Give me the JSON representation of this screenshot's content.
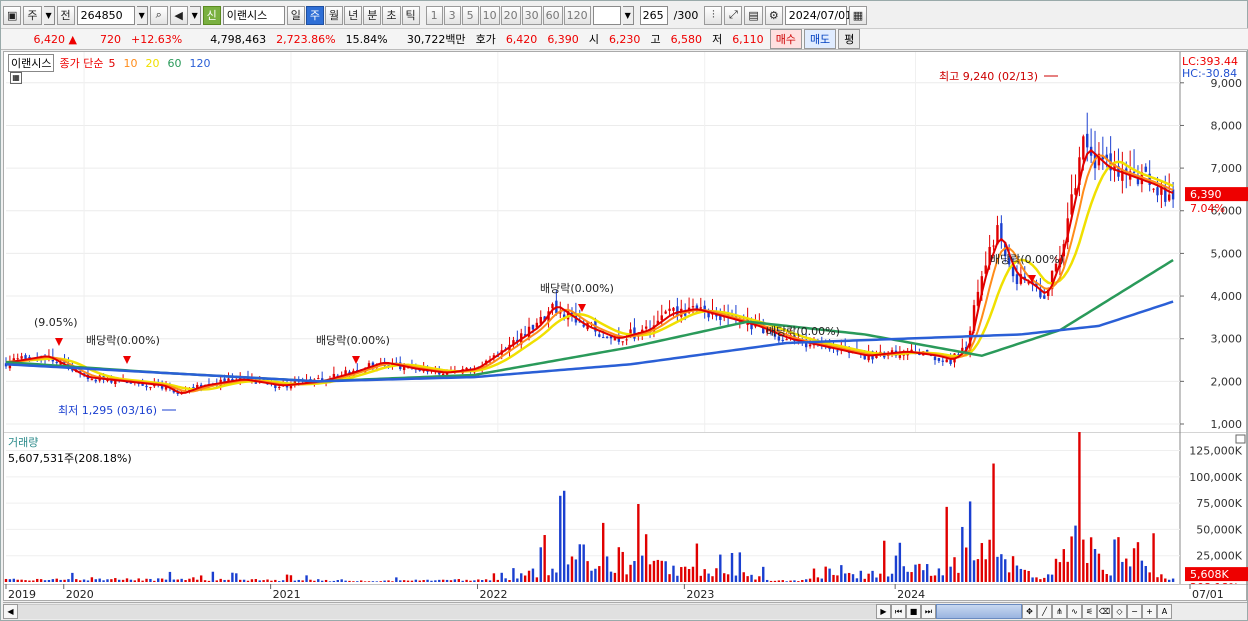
{
  "toolbar": {
    "period_label": "주",
    "prev_label": "전",
    "code": "264850",
    "credit_label": "신",
    "stock_name": "이랜시스",
    "periods": [
      {
        "label": "일",
        "selected": false
      },
      {
        "label": "주",
        "selected": true
      },
      {
        "label": "월",
        "selected": false
      },
      {
        "label": "년",
        "selected": false
      },
      {
        "label": "분",
        "selected": false
      },
      {
        "label": "초",
        "selected": false
      },
      {
        "label": "틱",
        "selected": false
      }
    ],
    "intervals": [
      "1",
      "3",
      "5",
      "10",
      "20",
      "30",
      "60",
      "120"
    ],
    "count": "265",
    "count_total": "/300",
    "date": "2024/07/01"
  },
  "quote": {
    "price": "6,420",
    "change": "720",
    "change_pct": "+12.63%",
    "volume": "4,798,463",
    "volume_pct": "2,723.86%",
    "turnover": "15.84%",
    "amount": "30,722백만",
    "hoga_label": "호가",
    "hoga_ask": "6,420",
    "hoga_bid": "6,390",
    "open_label": "시",
    "open": "6,230",
    "high_label": "고",
    "high": "6,580",
    "low_label": "저",
    "low": "6,110",
    "buy_label": "매수",
    "sell_label": "매도",
    "eval_label": "평"
  },
  "price_panel": {
    "name_tag": "이랜시스",
    "ma_title": "종가 단순",
    "ma_periods": [
      {
        "label": "5",
        "color": "#e00000"
      },
      {
        "label": "10",
        "color": "#ff8c1a"
      },
      {
        "label": "20",
        "color": "#f0e000"
      },
      {
        "label": "60",
        "color": "#2a9a5a"
      },
      {
        "label": "120",
        "color": "#2a5fd6"
      }
    ],
    "lc": "LC:393.44",
    "hc": "HC:-30.84",
    "y_ticks": [
      "9,000",
      "8,000",
      "7,000",
      "6,000",
      "5,000",
      "4,000",
      "3,000",
      "2,000",
      "1,000"
    ],
    "current_price": "6,390",
    "current_pct": "7.04%",
    "annotations": {
      "max": "최고 9,240 (02/13)",
      "min": "최저 1,295 (03/16)",
      "split": "(9.05%)",
      "div1": "배당락(0.00%)",
      "div2": "배당락(0.00%)",
      "div3": "배당락(0.00%)",
      "div4": "배당락(0.00%)",
      "div5": "배당락(0.00%)"
    }
  },
  "volume_panel": {
    "title": "거래량",
    "value": "5,607,531주(208.18%)",
    "y_ticks": [
      "125,000K",
      "100,000K",
      "75,000K",
      "50,000K",
      "25,000K"
    ],
    "current_vol": "5,608K",
    "current_pct": "208.18%"
  },
  "x_axis": [
    "2019",
    "2020",
    "2021",
    "2022",
    "2023",
    "2024",
    "07/01"
  ],
  "colors": {
    "up": "#e00000",
    "down": "#1a3fd0",
    "ma5": "#e00000",
    "ma10": "#ff8c1a",
    "ma20": "#f0e000",
    "ma60": "#2a9a5a",
    "ma120": "#2a5fd6"
  },
  "chart_data": {
    "type": "candlestick",
    "price_range": [
      1000,
      9300
    ],
    "weeks": 265,
    "close": [
      [
        0,
        2450
      ],
      [
        10,
        2600
      ],
      [
        14,
        2400
      ],
      [
        20,
        2100
      ],
      [
        30,
        2000
      ],
      [
        40,
        1900
      ],
      [
        44,
        1700
      ],
      [
        50,
        1900
      ],
      [
        60,
        2050
      ],
      [
        70,
        1900
      ],
      [
        80,
        2000
      ],
      [
        88,
        2200
      ],
      [
        96,
        2450
      ],
      [
        104,
        2300
      ],
      [
        112,
        2200
      ],
      [
        120,
        2300
      ],
      [
        128,
        2800
      ],
      [
        136,
        3300
      ],
      [
        140,
        3800
      ],
      [
        148,
        3300
      ],
      [
        156,
        3000
      ],
      [
        164,
        3200
      ],
      [
        170,
        3600
      ],
      [
        176,
        3700
      ],
      [
        184,
        3500
      ],
      [
        192,
        3300
      ],
      [
        200,
        3000
      ],
      [
        210,
        2800
      ],
      [
        220,
        2600
      ],
      [
        230,
        2700
      ],
      [
        238,
        2600
      ],
      [
        242,
        2500
      ],
      [
        246,
        2800
      ],
      [
        250,
        4500
      ],
      [
        254,
        5500
      ],
      [
        258,
        4500
      ],
      [
        262,
        4300
      ],
      [
        266,
        4000
      ],
      [
        270,
        5000
      ],
      [
        276,
        7500
      ],
      [
        282,
        7000
      ],
      [
        288,
        6800
      ],
      [
        294,
        6600
      ],
      [
        298,
        6400
      ]
    ],
    "ma120": [
      [
        0,
        2400
      ],
      [
        40,
        2200
      ],
      [
        80,
        2000
      ],
      [
        120,
        2100
      ],
      [
        160,
        2400
      ],
      [
        200,
        2900
      ],
      [
        230,
        3000
      ],
      [
        260,
        3100
      ],
      [
        280,
        3300
      ],
      [
        300,
        3900
      ]
    ],
    "ma60": [
      [
        0,
        2450
      ],
      [
        40,
        2200
      ],
      [
        80,
        2000
      ],
      [
        120,
        2150
      ],
      [
        160,
        2800
      ],
      [
        190,
        3400
      ],
      [
        220,
        3100
      ],
      [
        250,
        2600
      ],
      [
        270,
        3200
      ],
      [
        300,
        4900
      ]
    ],
    "volume_k": [
      [
        20,
        8000
      ],
      [
        94,
        2500
      ],
      [
        130,
        8000
      ],
      [
        146,
        62000
      ],
      [
        200,
        2000
      ],
      [
        240,
        38000
      ],
      [
        254,
        80000
      ],
      [
        256,
        65000
      ],
      [
        260,
        30000
      ],
      [
        266,
        8000
      ],
      [
        276,
        118000
      ],
      [
        282,
        15000
      ],
      [
        290,
        65000
      ],
      [
        298,
        5608
      ]
    ]
  }
}
